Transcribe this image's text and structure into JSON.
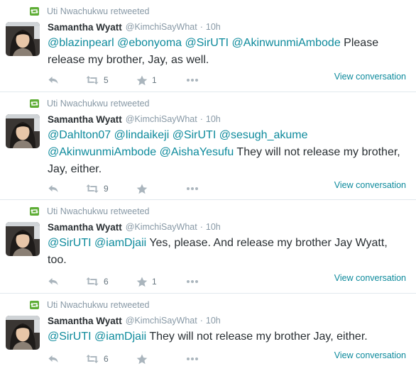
{
  "colors": {
    "link": "#0d8a9c",
    "secondary_text": "#8899a6",
    "retweet_badge": "#5ead36",
    "divider": "#e1e8ed"
  },
  "tweets": [
    {
      "retweeted_by": "Uti Nwachukwu retweeted",
      "fullname": "Samantha Wyatt",
      "username": "@KimchiSayWhat",
      "separator": "·",
      "time": "10h",
      "text": [
        {
          "type": "mention",
          "value": "@blazinpearl"
        },
        {
          "type": "text",
          "value": " "
        },
        {
          "type": "mention",
          "value": "@ebonyoma"
        },
        {
          "type": "text",
          "value": " "
        },
        {
          "type": "mention",
          "value": "@SirUTI"
        },
        {
          "type": "text",
          "value": " "
        },
        {
          "type": "mention",
          "value": "@AkinwunmiAmbode"
        },
        {
          "type": "text",
          "value": " Please release my brother, Jay, as well."
        }
      ],
      "retweet_count": "5",
      "favorite_count": "1",
      "view_conversation": "View conversation"
    },
    {
      "retweeted_by": "Uti Nwachukwu retweeted",
      "fullname": "Samantha Wyatt",
      "username": "@KimchiSayWhat",
      "separator": "·",
      "time": "10h",
      "text": [
        {
          "type": "mention",
          "value": "@Dahlton07"
        },
        {
          "type": "text",
          "value": " "
        },
        {
          "type": "mention",
          "value": "@lindaikeji"
        },
        {
          "type": "text",
          "value": " "
        },
        {
          "type": "mention",
          "value": "@SirUTI"
        },
        {
          "type": "text",
          "value": " "
        },
        {
          "type": "mention",
          "value": "@sesugh_akume"
        },
        {
          "type": "text",
          "value": " "
        },
        {
          "type": "mention",
          "value": "@AkinwunmiAmbode"
        },
        {
          "type": "text",
          "value": " "
        },
        {
          "type": "mention",
          "value": "@AishaYesufu"
        },
        {
          "type": "text",
          "value": " They will not release my brother, Jay, either."
        }
      ],
      "retweet_count": "9",
      "favorite_count": "",
      "view_conversation": "View conversation"
    },
    {
      "retweeted_by": "Uti Nwachukwu retweeted",
      "fullname": "Samantha Wyatt",
      "username": "@KimchiSayWhat",
      "separator": "·",
      "time": "10h",
      "text": [
        {
          "type": "mention",
          "value": "@SirUTI"
        },
        {
          "type": "text",
          "value": " "
        },
        {
          "type": "mention",
          "value": "@iamDjaii"
        },
        {
          "type": "text",
          "value": " Yes, please. And release my brother Jay Wyatt, too."
        }
      ],
      "retweet_count": "6",
      "favorite_count": "1",
      "view_conversation": "View conversation"
    },
    {
      "retweeted_by": "Uti Nwachukwu retweeted",
      "fullname": "Samantha Wyatt",
      "username": "@KimchiSayWhat",
      "separator": "·",
      "time": "10h",
      "text": [
        {
          "type": "mention",
          "value": "@SirUTI"
        },
        {
          "type": "text",
          "value": " "
        },
        {
          "type": "mention",
          "value": "@iamDjaii"
        },
        {
          "type": "text",
          "value": " They will not release my brother Jay, either."
        }
      ],
      "retweet_count": "6",
      "favorite_count": "",
      "view_conversation": "View conversation"
    }
  ],
  "icons": {
    "context": "retweet-badge-icon",
    "reply": "reply-icon",
    "retweet": "retweet-icon",
    "favorite": "star-icon",
    "more": "more-dots-icon"
  }
}
